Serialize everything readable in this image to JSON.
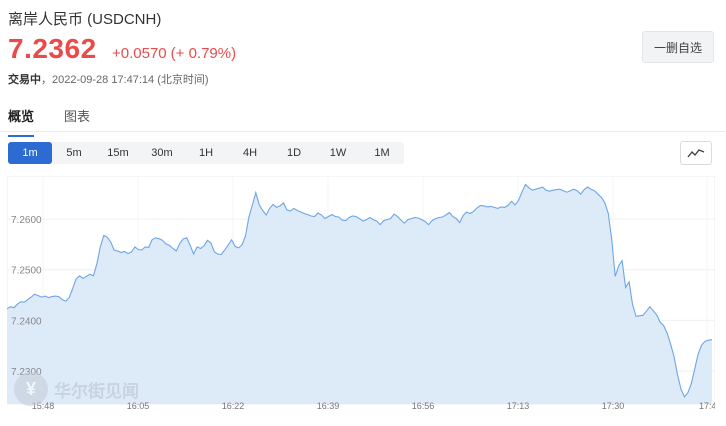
{
  "header": {
    "title": "离岸人民币 (USDCNH)",
    "price": "7.2362",
    "change": "+0.0570",
    "change_pct": "(+ 0.79%)",
    "status_label": "交易中",
    "timestamp": "，2022-09-28 17:47:14 (北京时间)",
    "watchlist_button": "一删自选"
  },
  "tabs": [
    {
      "label": "概览",
      "active": true
    },
    {
      "label": "图表",
      "active": false
    }
  ],
  "periods": [
    {
      "label": "1m",
      "active": true
    },
    {
      "label": "5m"
    },
    {
      "label": "15m"
    },
    {
      "label": "30m"
    },
    {
      "label": "1H"
    },
    {
      "label": "4H"
    },
    {
      "label": "1D"
    },
    {
      "label": "1W"
    },
    {
      "label": "1M"
    }
  ],
  "icons": {
    "chart_type": "line-chart-icon",
    "watermark_logo": "wallstreetcn-logo"
  },
  "watermark": {
    "text": "华尔街见闻"
  },
  "colors": {
    "up": "#e94b4b",
    "accent": "#2c6bd1",
    "area_fill": "#ddebf9",
    "area_line": "#6ea5e6"
  },
  "chart_data": {
    "type": "area",
    "y_tick_labels": [
      "7.2600",
      "7.2500",
      "7.2400",
      "7.2300"
    ],
    "y_ticks": [
      7.26,
      7.25,
      7.24,
      7.23
    ],
    "ylim": [
      7.2235,
      7.2685
    ],
    "x_tick_labels": [
      "15:48",
      "16:05",
      "16:22",
      "16:39",
      "16:56",
      "17:13",
      "17:30",
      "17:4"
    ],
    "x": [
      0,
      1,
      2,
      3,
      4,
      5,
      6,
      7,
      8,
      9,
      10,
      11,
      12,
      13,
      14,
      15,
      16,
      17,
      18,
      19,
      20,
      21,
      22,
      23,
      24,
      25,
      26,
      27,
      28,
      29,
      30,
      31,
      32,
      33,
      34,
      35,
      36,
      37,
      38,
      39,
      40,
      41,
      42,
      43,
      44,
      45,
      46,
      47,
      48,
      49,
      50,
      51,
      52,
      53,
      54,
      55,
      56,
      57,
      58,
      59,
      60,
      61,
      62,
      63,
      64,
      65,
      66,
      67,
      68,
      69,
      70,
      71,
      72,
      73,
      74,
      75,
      76,
      77,
      78,
      79,
      80,
      81,
      82,
      83,
      84,
      85,
      86,
      87,
      88,
      89,
      90,
      91,
      92,
      93,
      94,
      95,
      96,
      97,
      98,
      99,
      100,
      101,
      102,
      103,
      104,
      105,
      106,
      107,
      108,
      109,
      110,
      111,
      112,
      113,
      114,
      115,
      116,
      117,
      118,
      119,
      120,
      121,
      122,
      123,
      124,
      125,
      126,
      127,
      128,
      129,
      130,
      131,
      132,
      133,
      134,
      135,
      136,
      137,
      138,
      139,
      140,
      141,
      142,
      143,
      144,
      145,
      146,
      147,
      148,
      149,
      150,
      151,
      152,
      153,
      154,
      155,
      156,
      157,
      158,
      159,
      160,
      161,
      162,
      163,
      164,
      165,
      166,
      167,
      168,
      169,
      170,
      171,
      172,
      173,
      174,
      175,
      176,
      177,
      178,
      179,
      180,
      181,
      182,
      183,
      184,
      185,
      186,
      187,
      188,
      189,
      190,
      191,
      192,
      193,
      194,
      195,
      196,
      197,
      198,
      199,
      200,
      201,
      202,
      203,
      204,
      205
    ],
    "values": [
      7.2423,
      7.2427,
      7.2425,
      7.2432,
      7.2437,
      7.2436,
      7.2441,
      7.2446,
      7.2452,
      7.2449,
      7.2446,
      7.2448,
      7.2445,
      7.2447,
      7.2448,
      7.2447,
      7.2441,
      7.2438,
      7.2445,
      7.2463,
      7.2482,
      7.2488,
      7.2483,
      7.2487,
      7.2491,
      7.2488,
      7.2512,
      7.2545,
      7.2568,
      7.2564,
      7.2555,
      7.2539,
      7.2537,
      7.2534,
      7.2536,
      7.2532,
      7.2535,
      7.2545,
      7.254,
      7.2539,
      7.2545,
      7.2544,
      7.2559,
      7.2563,
      7.2561,
      7.2558,
      7.2551,
      7.2548,
      7.2542,
      7.2537,
      7.2552,
      7.2561,
      7.2563,
      7.2548,
      7.2531,
      7.2545,
      7.2542,
      7.2547,
      7.2558,
      7.2553,
      7.2535,
      7.2531,
      7.253,
      7.2539,
      7.2549,
      7.2559,
      7.2546,
      7.2543,
      7.2549,
      7.2567,
      7.2604,
      7.2628,
      7.2652,
      7.2628,
      7.2617,
      7.2608,
      7.2621,
      7.2629,
      7.2623,
      7.2626,
      7.2632,
      7.2618,
      7.2616,
      7.2621,
      7.2617,
      7.2614,
      7.2611,
      7.2609,
      7.2606,
      7.2605,
      7.2612,
      7.2608,
      7.2601,
      7.2605,
      7.2609,
      7.2605,
      7.2604,
      7.2598,
      7.2597,
      7.2603,
      7.2606,
      7.2605,
      7.2601,
      7.2596,
      7.2599,
      7.2603,
      7.2599,
      7.2596,
      7.2589,
      7.2597,
      7.2599,
      7.2601,
      7.261,
      7.2605,
      7.2598,
      7.2592,
      7.2599,
      7.2601,
      7.2603,
      7.2602,
      7.2599,
      7.2595,
      7.2589,
      7.2597,
      7.2601,
      7.2603,
      7.2604,
      7.2608,
      7.2613,
      7.2605,
      7.2601,
      7.2593,
      7.2607,
      7.2614,
      7.2611,
      7.2615,
      7.2622,
      7.2627,
      7.2626,
      7.2624,
      7.2625,
      7.2623,
      7.2621,
      7.2624,
      7.2623,
      7.2627,
      7.2635,
      7.2628,
      7.2637,
      7.2653,
      7.2668,
      7.2662,
      7.2657,
      7.2659,
      7.2661,
      7.2663,
      7.2657,
      7.2655,
      7.2657,
      7.2658,
      7.2659,
      7.2656,
      7.2653,
      7.2656,
      7.2659,
      7.2656,
      7.2649,
      7.2658,
      7.2663,
      7.2659,
      7.2656,
      7.2649,
      7.2643,
      7.2632,
      7.2611,
      7.2558,
      7.2487,
      7.2508,
      7.2518,
      7.2465,
      7.2476,
      7.2432,
      7.2408,
      7.2409,
      7.241,
      7.2418,
      7.2427,
      7.2419,
      7.2411,
      7.2396,
      7.239,
      7.2375,
      7.2354,
      7.2329,
      7.2294,
      7.2265,
      7.2249,
      7.2257,
      7.2275,
      7.2304,
      7.2334,
      7.2351,
      7.2359,
      7.2361,
      7.2362
    ],
    "grid": true,
    "legend": "none"
  }
}
